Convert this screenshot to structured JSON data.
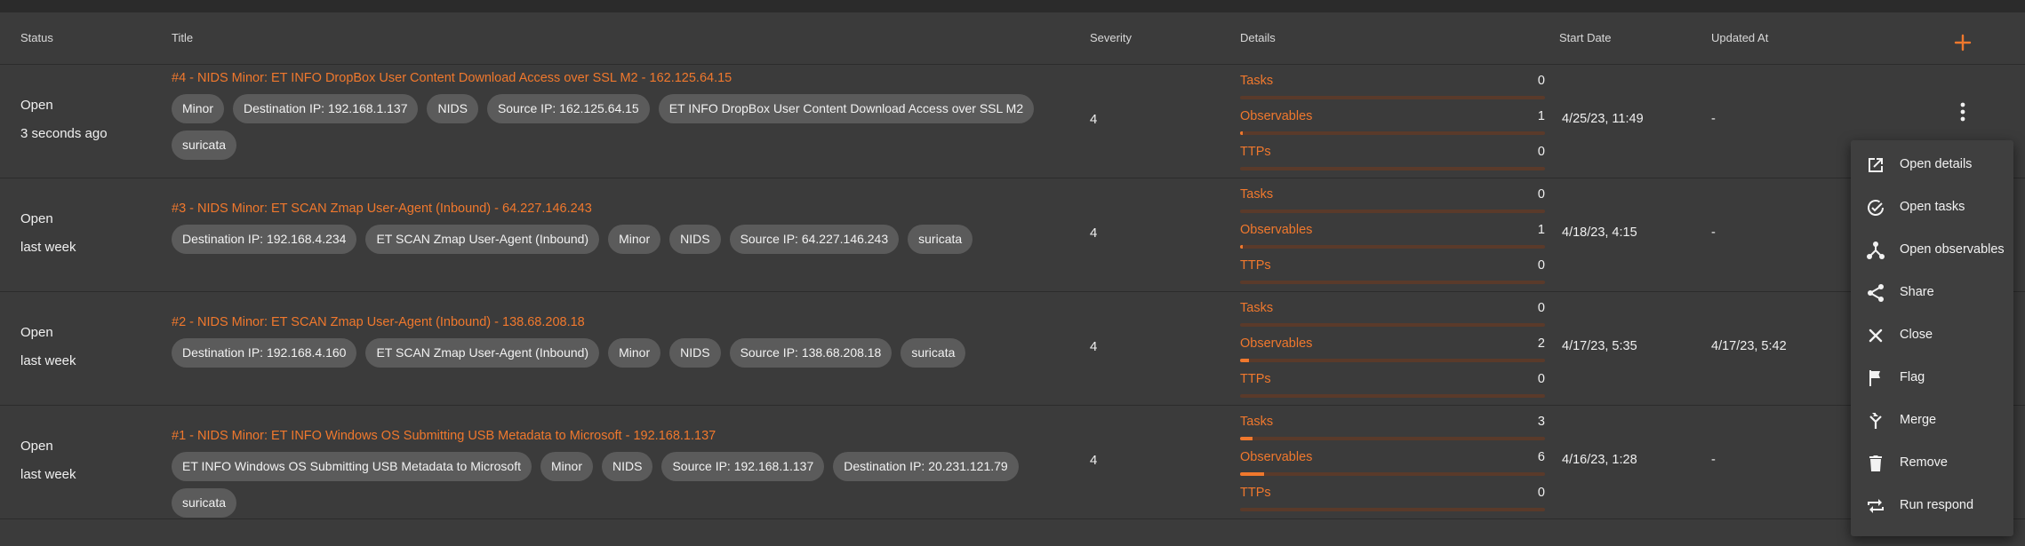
{
  "header": {
    "status": "Status",
    "title": "Title",
    "severity": "Severity",
    "details": "Details",
    "start_date": "Start Date",
    "updated_at": "Updated At",
    "add_icon": "plus-icon"
  },
  "rows": [
    {
      "status": "Open",
      "time": "3 seconds ago",
      "title": "#4 - NIDS Minor: ET INFO DropBox User Content Download Access over SSL M2 - 162.125.64.15",
      "tags": [
        "Minor",
        "Destination IP: 192.168.1.137",
        "NIDS",
        "Source IP: 162.125.64.15",
        "ET INFO DropBox User Content Download Access over SSL M2",
        "suricata"
      ],
      "severity": "4",
      "details": [
        {
          "label": "Tasks",
          "count": "0",
          "fill": 0
        },
        {
          "label": "Observables",
          "count": "1",
          "fill": 0.01
        },
        {
          "label": "TTPs",
          "count": "0",
          "fill": 0
        }
      ],
      "start_date": "4/25/23, 11:49",
      "updated_at": "-"
    },
    {
      "status": "Open",
      "time": "last week",
      "title": "#3 - NIDS Minor: ET SCAN Zmap User-Agent (Inbound) - 64.227.146.243",
      "tags": [
        "Destination IP: 192.168.4.234",
        "ET SCAN Zmap User-Agent (Inbound)",
        "Minor",
        "NIDS",
        "Source IP: 64.227.146.243",
        "suricata"
      ],
      "severity": "4",
      "details": [
        {
          "label": "Tasks",
          "count": "0",
          "fill": 0
        },
        {
          "label": "Observables",
          "count": "1",
          "fill": 0.01
        },
        {
          "label": "TTPs",
          "count": "0",
          "fill": 0
        }
      ],
      "start_date": "4/18/23, 4:15",
      "updated_at": "-"
    },
    {
      "status": "Open",
      "time": "last week",
      "title": "#2 - NIDS Minor: ET SCAN Zmap User-Agent (Inbound) - 138.68.208.18",
      "tags": [
        "Destination IP: 192.168.4.160",
        "ET SCAN Zmap User-Agent (Inbound)",
        "Minor",
        "NIDS",
        "Source IP: 138.68.208.18",
        "suricata"
      ],
      "severity": "4",
      "details": [
        {
          "label": "Tasks",
          "count": "0",
          "fill": 0
        },
        {
          "label": "Observables",
          "count": "2",
          "fill": 0.03
        },
        {
          "label": "TTPs",
          "count": "0",
          "fill": 0
        }
      ],
      "start_date": "4/17/23, 5:35",
      "updated_at": "4/17/23, 5:42"
    },
    {
      "status": "Open",
      "time": "last week",
      "title": "#1 - NIDS Minor: ET INFO Windows OS Submitting USB Metadata to Microsoft - 192.168.1.137",
      "tags": [
        "ET INFO Windows OS Submitting USB Metadata to Microsoft",
        "Minor",
        "NIDS",
        "Source IP: 192.168.1.137",
        "Destination IP: 20.231.121.79",
        "suricata"
      ],
      "severity": "4",
      "details": [
        {
          "label": "Tasks",
          "count": "3",
          "fill": 0.04
        },
        {
          "label": "Observables",
          "count": "6",
          "fill": 0.08
        },
        {
          "label": "TTPs",
          "count": "0",
          "fill": 0
        }
      ],
      "start_date": "4/16/23, 1:28",
      "updated_at": "-"
    }
  ],
  "menu": [
    {
      "label": "Open details",
      "icon": "open-in-new-icon"
    },
    {
      "label": "Open tasks",
      "icon": "check-circle-icon"
    },
    {
      "label": "Open observables",
      "icon": "hub-icon"
    },
    {
      "label": "Share",
      "icon": "share-icon"
    },
    {
      "label": "Close",
      "icon": "close-icon"
    },
    {
      "label": "Flag",
      "icon": "flag-icon"
    },
    {
      "label": "Merge",
      "icon": "merge-icon"
    },
    {
      "label": "Remove",
      "icon": "trash-icon"
    },
    {
      "label": "Run respond",
      "icon": "repeat-icon"
    }
  ],
  "colors": {
    "accent": "#f0782d",
    "background": "#3b3b3b",
    "tag": "#5b5b5b"
  }
}
